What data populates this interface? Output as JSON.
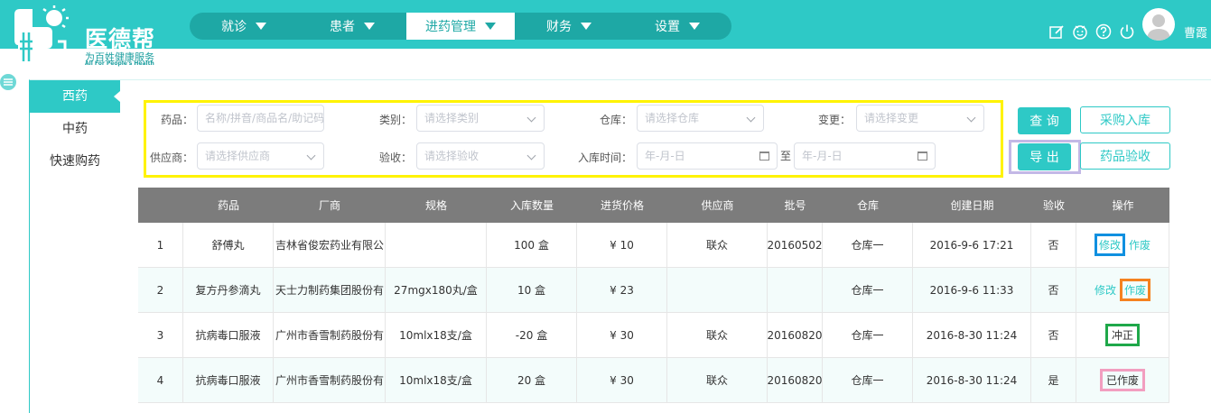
{
  "app": {
    "brand_name": "医德帮",
    "slogan": "为百姓健康服务",
    "slogan_en": "All For People's Health",
    "accent_color": "#2ec9c6",
    "username": "曹霞"
  },
  "nav": {
    "items": [
      {
        "label": "就诊"
      },
      {
        "label": "患者"
      },
      {
        "label": "进药管理",
        "active": true
      },
      {
        "label": "财务"
      },
      {
        "label": "设置"
      }
    ]
  },
  "header_icons": [
    "edit-icon",
    "smile-icon",
    "help-icon",
    "power-icon"
  ],
  "subnav": {
    "items": [
      {
        "label": "西药",
        "active": true
      },
      {
        "label": "中药"
      },
      {
        "label": "快速购药"
      }
    ]
  },
  "filters": {
    "drug_label": "药品：",
    "drug_placeholder": "名称/拼音/商品名/助记码",
    "category_label": "类别：",
    "category_placeholder": "请选择类别",
    "warehouse_label": "仓库：",
    "warehouse_placeholder": "请选择仓库",
    "change_label": "变更：",
    "change_placeholder": "请选择变更",
    "supplier_label": "供应商：",
    "supplier_placeholder": "请选择供应商",
    "accept_label": "验收：",
    "accept_placeholder": "请选择验收",
    "date_label": "入库时间：",
    "date_start_placeholder": "年-月-日",
    "date_to": "至",
    "date_end_placeholder": "年-月-日"
  },
  "buttons": {
    "query": "查 询",
    "purchase_in": "采购入库",
    "export": "导 出",
    "drug_accept": "药品验收"
  },
  "table": {
    "headers": [
      "",
      "药品",
      "厂商",
      "规格",
      "入库数量",
      "进货价格",
      "供应商",
      "批号",
      "仓库",
      "创建日期",
      "验收",
      "操作"
    ],
    "rows": [
      {
        "no": "1",
        "drug": "舒傅丸",
        "maker": "吉林省俊宏药业有限公",
        "spec": "",
        "qty": "100 盒",
        "price": "¥ 10",
        "supplier": "联众",
        "batch": "20160502",
        "warehouse": "仓库一",
        "date": "2016-9-6 17:21",
        "accepted": "否",
        "op1": "修改",
        "op2": "作废"
      },
      {
        "no": "2",
        "drug": "复方丹参滴丸",
        "maker": "天士力制药集团股份有",
        "spec": "27mgx180丸/盒",
        "qty": "10 盒",
        "price": "¥ 23",
        "supplier": "",
        "batch": "",
        "warehouse": "仓库一",
        "date": "2016-9-6 11:33",
        "accepted": "否",
        "op1": "修改",
        "op2": "作废"
      },
      {
        "no": "3",
        "drug": "抗病毒口服液",
        "maker": "广州市香雪制药股份有",
        "spec": "10mlx18支/盒",
        "qty": "-20 盒",
        "price": "¥ 30",
        "supplier": "联众",
        "batch": "20160820",
        "warehouse": "仓库一",
        "date": "2016-8-30 11:24",
        "accepted": "否",
        "op1": "冲正"
      },
      {
        "no": "4",
        "drug": "抗病毒口服液",
        "maker": "广州市香雪制药股份有",
        "spec": "10mlx18支/盒",
        "qty": "20 盒",
        "price": "¥ 30",
        "supplier": "联众",
        "batch": "20160820",
        "warehouse": "仓库一",
        "date": "2016-8-30 11:24",
        "accepted": "是",
        "op1": "已作废"
      }
    ]
  }
}
